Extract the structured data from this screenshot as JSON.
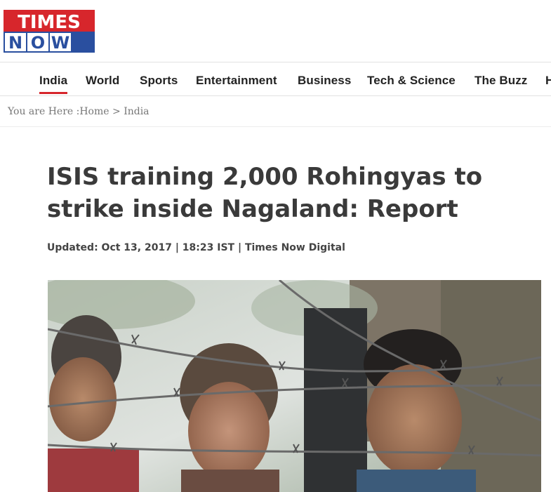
{
  "logo": {
    "line1": "TIMES",
    "line2": "NOW",
    "brand_red": "#d7262c",
    "brand_blue": "#2a4f9f"
  },
  "nav": {
    "items": [
      {
        "label": "India",
        "active": true
      },
      {
        "label": "World"
      },
      {
        "label": "Sports"
      },
      {
        "label": "Entertainment"
      },
      {
        "label": "Business"
      },
      {
        "label": "Tech & Science"
      },
      {
        "label": "The Buzz"
      },
      {
        "label": "H"
      }
    ]
  },
  "breadcrumb": {
    "prefix": "You are Here",
    "separator_colon": ":",
    "home": "Home",
    "arrow": ">",
    "current": "India"
  },
  "article": {
    "title": "ISIS training 2,000 Rohingyas to strike inside Nagaland: Report",
    "meta": "Updated: Oct 13, 2017 | 18:23 IST | Times Now Digital"
  },
  "colors": {
    "accent": "#d7262c",
    "text": "#3a3a3a"
  }
}
